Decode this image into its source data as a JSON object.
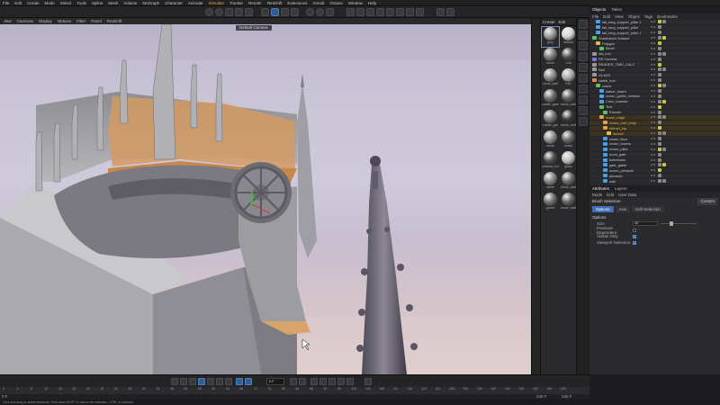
{
  "menu": [
    "File",
    "Edit",
    "Create",
    "Mode",
    "Select",
    "Tools",
    "Spline",
    "Mesh",
    "Volume",
    "MoGraph",
    "Character",
    "Animate",
    "Simulate",
    "Tracker",
    "Render",
    "Redshift",
    "Extensions",
    "Arnold",
    "Octane",
    "Window",
    "Help"
  ],
  "menu_active_index": 12,
  "viewport": {
    "menu": [
      "View",
      "Cameras",
      "Display",
      "Options",
      "Filter",
      "Panel",
      "Redshift"
    ],
    "camera_label": "Default Camera"
  },
  "materials": {
    "menu": [
      "Create",
      "Edit"
    ],
    "items": [
      {
        "name": "grey"
      },
      {
        "name": "default"
      },
      {
        "name": "stone"
      },
      {
        "name": "roof"
      },
      {
        "name": "stone_wall"
      },
      {
        "name": "trim"
      },
      {
        "name": "castle_gate"
      },
      {
        "name": "stone_wall"
      },
      {
        "name": "castle_gat"
      },
      {
        "name": "stone_roof"
      },
      {
        "name": "stone"
      },
      {
        "name": "metal"
      },
      {
        "name": "window_fra"
      },
      {
        "name": "glass"
      },
      {
        "name": "stone"
      },
      {
        "name": "stone_wall"
      },
      {
        "name": "gravel"
      },
      {
        "name": "stone_wall"
      }
    ]
  },
  "objects": {
    "tabs": [
      "Objects",
      "Takes"
    ],
    "menu": [
      "File",
      "Edit",
      "View",
      "Object",
      "Tags",
      "Bookmarks"
    ],
    "rows": [
      {
        "name": "tall_long_support_pillar 1"
      },
      {
        "name": "tall_long_support_pillar"
      },
      {
        "name": "tall_long_support_pillar 1"
      },
      {
        "name": "Subdivision Surface"
      },
      {
        "name": "Polygon"
      },
      {
        "name": "Bevel"
      },
      {
        "name": "old_tool"
      },
      {
        "name": "RS Camera"
      },
      {
        "name": "RENDER_TIME_CALC"
      },
      {
        "name": "Null"
      },
      {
        "name": "GLASS"
      },
      {
        "name": "castle_tool"
      },
      {
        "name": "cubes"
      },
      {
        "name": "statue_board"
      },
      {
        "name": "crown_gothic_window"
      },
      {
        "name": "Crew_rosewin"
      },
      {
        "name": "Text"
      },
      {
        "name": "Extrude"
      },
      {
        "name": "crown_edge"
      },
      {
        "name": "crown_roof_body"
      },
      {
        "name": "helmet_top"
      },
      {
        "name": "helmet"
      },
      {
        "name": "crown_floor"
      },
      {
        "name": "crown_towers"
      },
      {
        "name": "crown_pillar"
      },
      {
        "name": "room_gate"
      },
      {
        "name": "buttresses"
      },
      {
        "name": "gate_gable"
      },
      {
        "name": "crown_pinnacle"
      },
      {
        "name": "pinnacle"
      },
      {
        "name": "wall"
      }
    ]
  },
  "attributes": {
    "tabs": [
      "Attributes",
      "Layers"
    ],
    "menu": [
      "Mode",
      "Edit",
      "User Data"
    ],
    "title": "Brush Selection",
    "mode": "Custom",
    "subtabs": [
      "Options",
      "Axis",
      "Soft Selection"
    ],
    "section": "Options",
    "fields": [
      {
        "label": "Size",
        "value": "10"
      },
      {
        "label": "Pressure Dependent",
        "checked": false
      },
      {
        "label": "Visible Only",
        "checked": true
      },
      {
        "label": "Viewport Selection",
        "checked": true
      }
    ]
  },
  "timeline": {
    "frame": "0 F",
    "ticks": [
      "0",
      "4",
      "8",
      "12",
      "16",
      "20",
      "24",
      "28",
      "32",
      "36",
      "40",
      "44",
      "48",
      "52",
      "56",
      "60",
      "64",
      "68",
      "72",
      "76",
      "80",
      "84",
      "88",
      "92",
      "96",
      "100",
      "104",
      "108",
      "112",
      "116",
      "120",
      "124",
      "128",
      "132",
      "136",
      "140",
      "144",
      "148",
      "152",
      "156",
      "160"
    ],
    "range_start": "0 F",
    "range_end": "240 F",
    "end": "240 F"
  },
  "status": "Click and drag to select elements. Hold down SHIFT to add to the selection. CTRL to subtract."
}
